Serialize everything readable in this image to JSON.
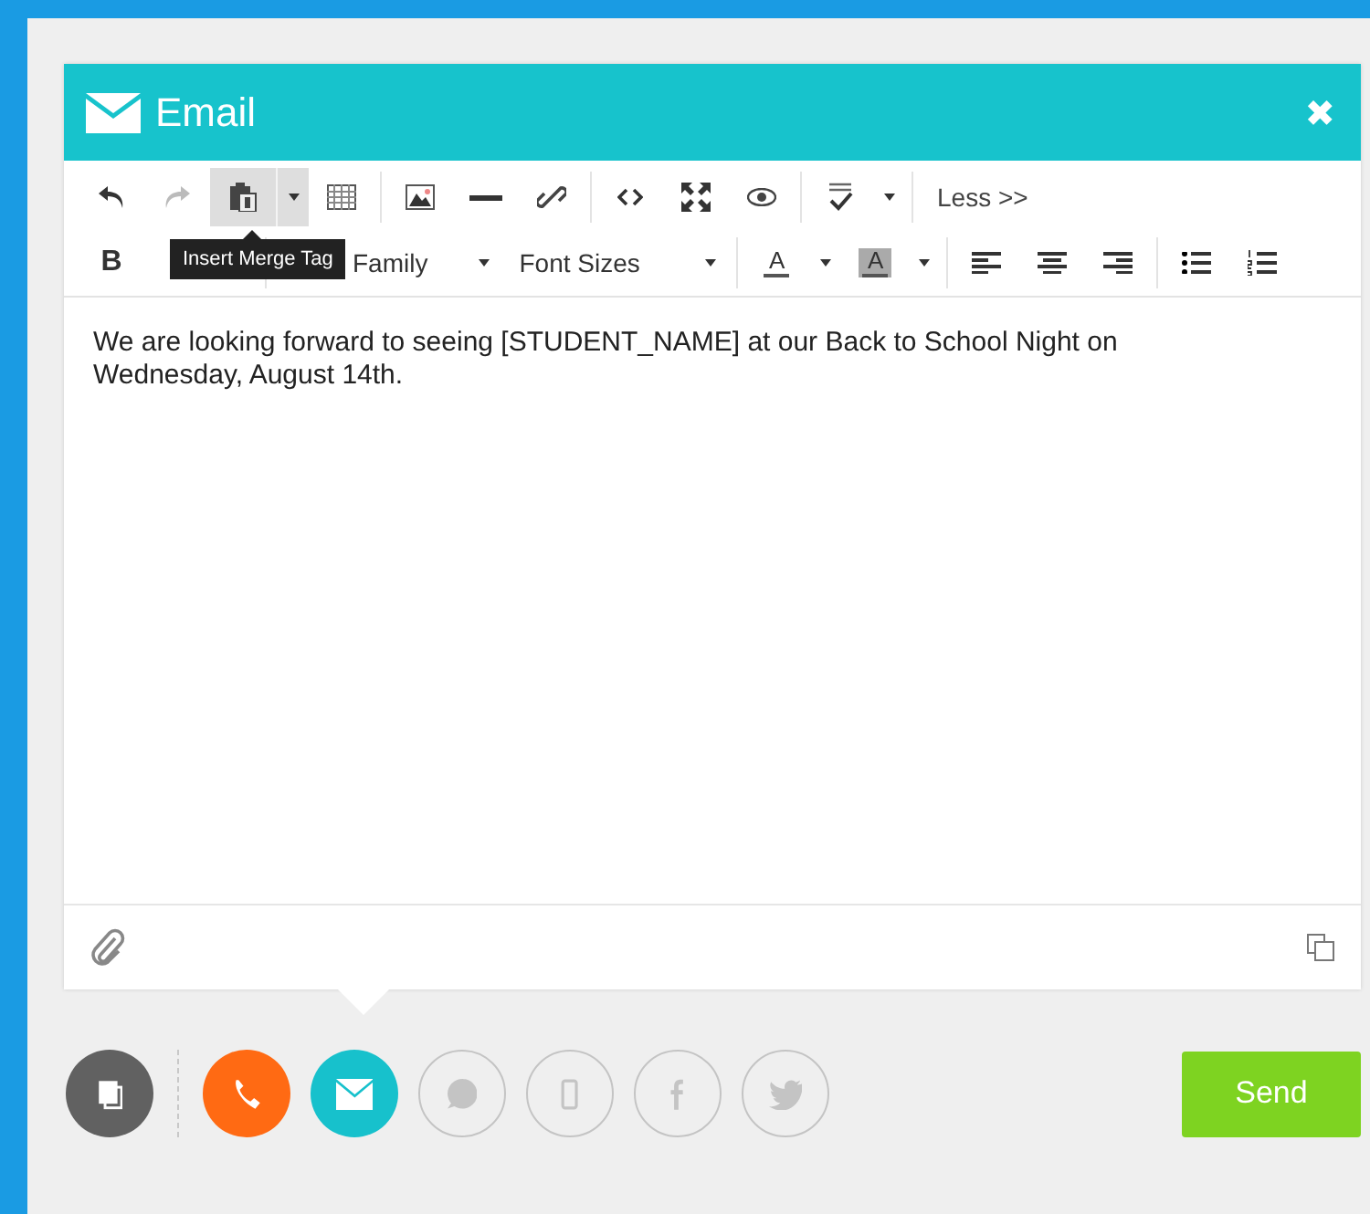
{
  "window": {
    "title": "Email",
    "close": "✖"
  },
  "toolbar": {
    "redo_disabled": true,
    "merge_tag_pressed": true,
    "less_label": "Less >>",
    "bold_label": "B",
    "font_family": "Family",
    "font_sizes": "Font Sizes",
    "text_color_label": "A",
    "bg_color_label": "A",
    "tooltip": "Insert Merge Tag"
  },
  "editor": {
    "body": "We are looking forward to seeing [STUDENT_NAME] at our Back to School Night on Wednesday, August 14th."
  },
  "channels": [
    {
      "kind": "template",
      "active": true,
      "color": "#616161"
    },
    {
      "kind": "phone",
      "active": true,
      "color": "#ff6a13"
    },
    {
      "kind": "email",
      "active": true,
      "color": "#17c1cc"
    },
    {
      "kind": "chat",
      "active": false
    },
    {
      "kind": "mobile",
      "active": false
    },
    {
      "kind": "facebook",
      "active": false
    },
    {
      "kind": "twitter",
      "active": false
    }
  ],
  "send_button": "Send"
}
